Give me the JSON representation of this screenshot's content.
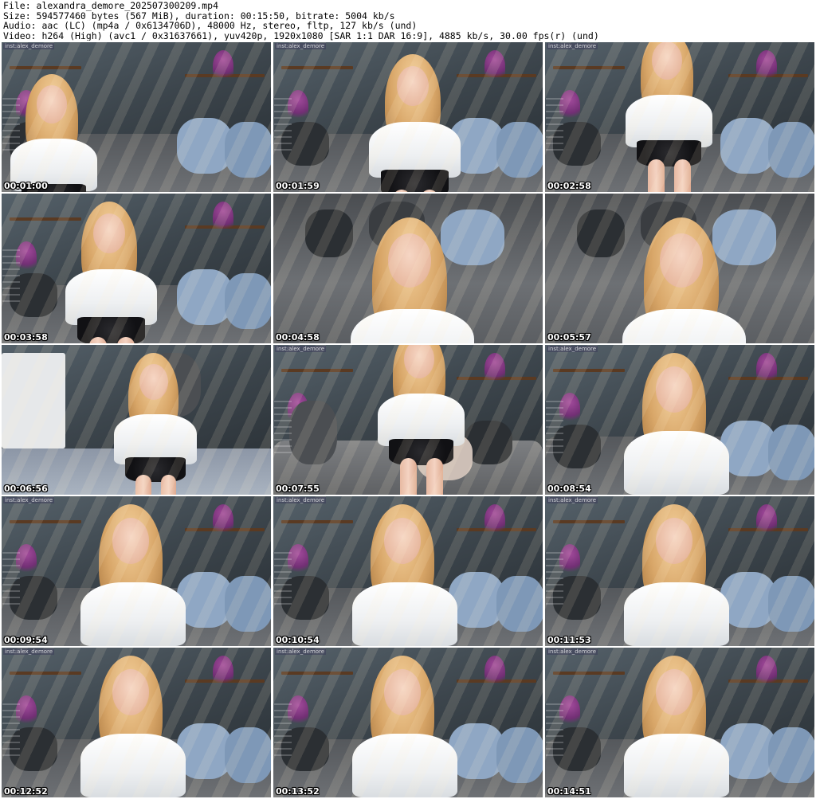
{
  "header": {
    "file": "File: alexandra_demore_202507300209.mp4",
    "size": "Size: 594577460 bytes (567 MiB), duration: 00:15:50, bitrate: 5004 kb/s",
    "audio": "Audio: aac (LC) (mp4a / 0x6134706D), 48000 Hz, stereo, fltp, 127 kb/s (und)",
    "video": "Video: h264 (High) (avc1 / 0x31637661), yuv420p, 1920x1080 [SAR 1:1 DAR 16:9], 4885 kb/s, 30.00 fps(r) (und)"
  },
  "thumbnails": [
    {
      "timestamp": "00:01:00",
      "watermark": "inst:alex_demore",
      "scene": "sofa-reclining"
    },
    {
      "timestamp": "00:01:59",
      "watermark": "inst:alex_demore",
      "scene": "sofa-dance"
    },
    {
      "timestamp": "00:02:58",
      "watermark": "inst:alex_demore",
      "scene": "standing-arms-out"
    },
    {
      "timestamp": "00:03:58",
      "watermark": "",
      "scene": "sofa-sitting"
    },
    {
      "timestamp": "00:04:58",
      "watermark": "",
      "scene": "closeup-sofa"
    },
    {
      "timestamp": "00:05:57",
      "watermark": "",
      "scene": "closeup-sofa"
    },
    {
      "timestamp": "00:06:56",
      "watermark": "",
      "scene": "floor-sitting"
    },
    {
      "timestamp": "00:07:55",
      "watermark": "inst:alex_demore",
      "scene": "standing-room"
    },
    {
      "timestamp": "00:08:54",
      "watermark": "inst:alex_demore",
      "scene": "sofa-front"
    },
    {
      "timestamp": "00:09:54",
      "watermark": "inst:alex_demore",
      "scene": "sofa-front"
    },
    {
      "timestamp": "00:10:54",
      "watermark": "inst:alex_demore",
      "scene": "sofa-front"
    },
    {
      "timestamp": "00:11:53",
      "watermark": "inst:alex_demore",
      "scene": "sofa-front"
    },
    {
      "timestamp": "00:12:52",
      "watermark": "inst:alex_demore",
      "scene": "sofa-front"
    },
    {
      "timestamp": "00:13:52",
      "watermark": "inst:alex_demore",
      "scene": "sofa-front"
    },
    {
      "timestamp": "00:14:51",
      "watermark": "inst:alex_demore",
      "scene": "sofa-front"
    }
  ],
  "colors": {
    "wall": "#3c454c",
    "sofa_dark": "#2b2f33",
    "sofa_grey": "#6d7074",
    "pillow_blue": "#8fa7c4",
    "blouse": "#f4f5f7",
    "hair": "#d8a668"
  }
}
